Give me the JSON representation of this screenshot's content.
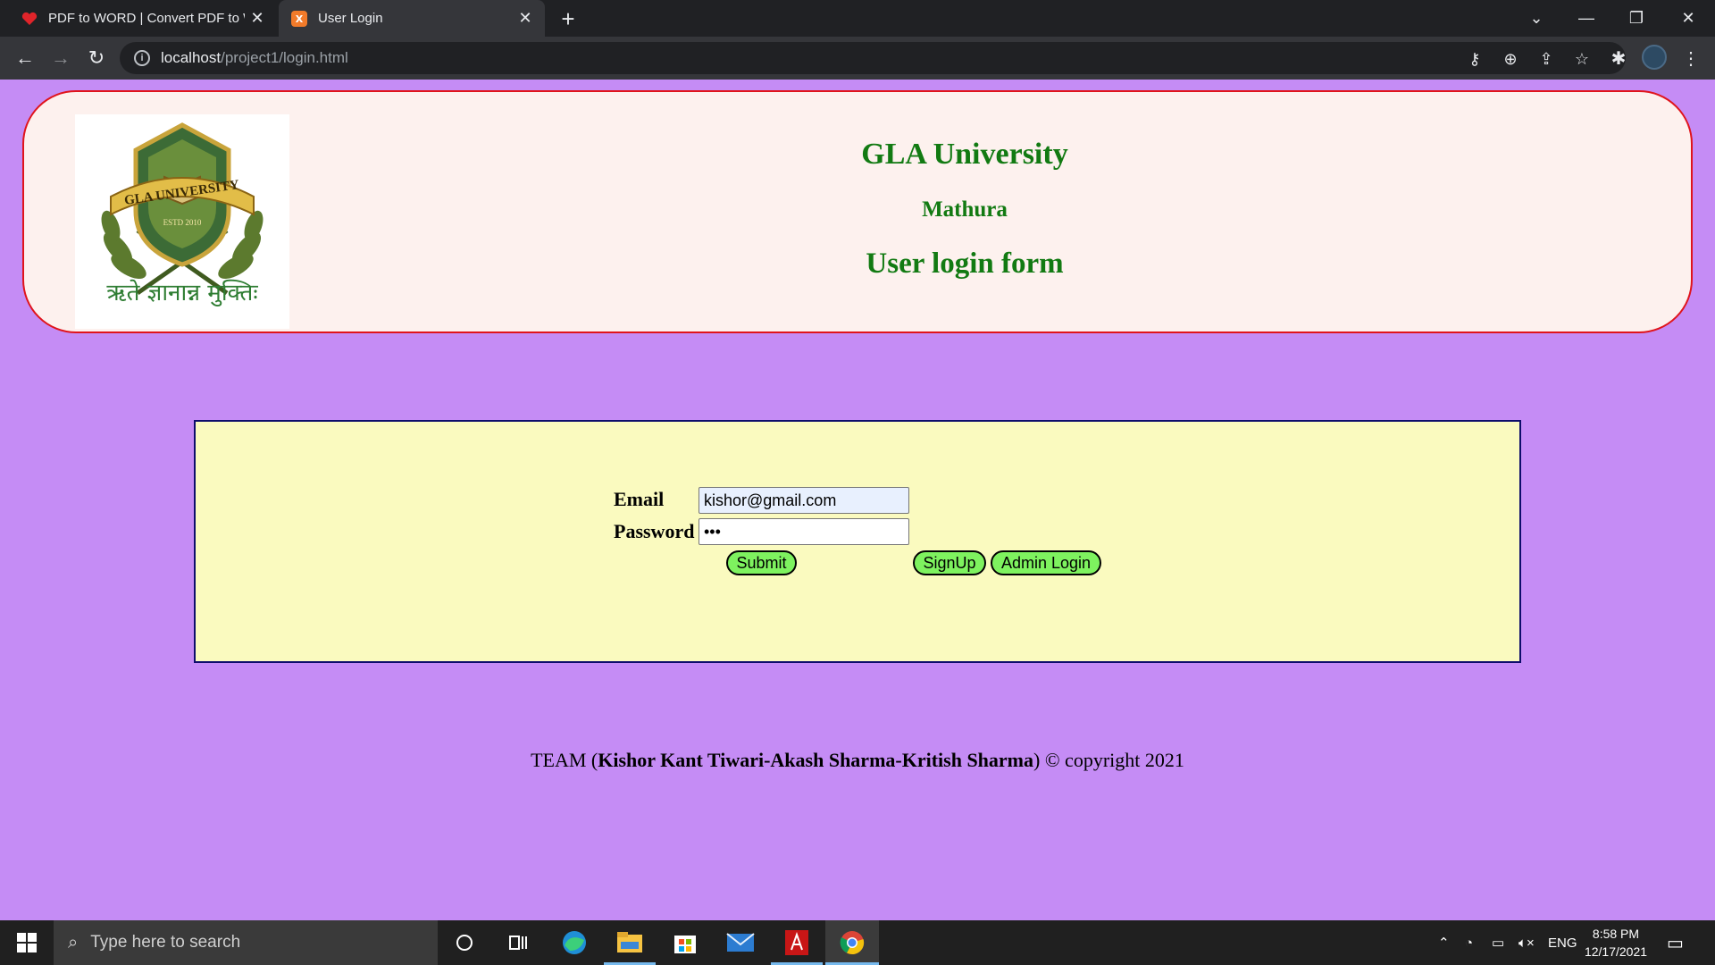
{
  "browser": {
    "tabs": [
      {
        "title": "PDF to WORD | Convert PDF to W",
        "icon": "heart-favicon-icon",
        "active": false
      },
      {
        "title": "User Login",
        "icon": "xampp-favicon-icon",
        "active": true
      }
    ],
    "url_host": "localhost",
    "url_path": "/project1/login.html"
  },
  "header": {
    "title": "GLA University",
    "subtitle": "Mathura",
    "form_title": "User login form",
    "logo_text": "GLA UNIVERSITY",
    "logo_estd": "ESTD 2010",
    "logo_motto": "ऋते ज्ञानान्न मुक्तिः"
  },
  "login": {
    "email_label": "Email",
    "email_value": "kishor@gmail.com",
    "password_label": "Password",
    "password_value": "•••",
    "submit_label": "Submit",
    "signup_label": "SignUp",
    "admin_label": "Admin Login"
  },
  "footer": {
    "prefix": "TEAM (",
    "team": "Kishor Kant Tiwari-Akash Sharma-Kritish Sharma",
    "suffix": ") © copyright 2021"
  },
  "taskbar": {
    "search_placeholder": "Type here to search",
    "language": "ENG",
    "time": "8:58 PM",
    "date": "12/17/2021"
  },
  "colors": {
    "page_bg": "#c58cf5",
    "header_bg": "#fdf1ee",
    "header_border": "#e0141c",
    "heading_color": "#127a12",
    "login_bg": "#fafabf",
    "button_bg": "#7ef25f"
  }
}
